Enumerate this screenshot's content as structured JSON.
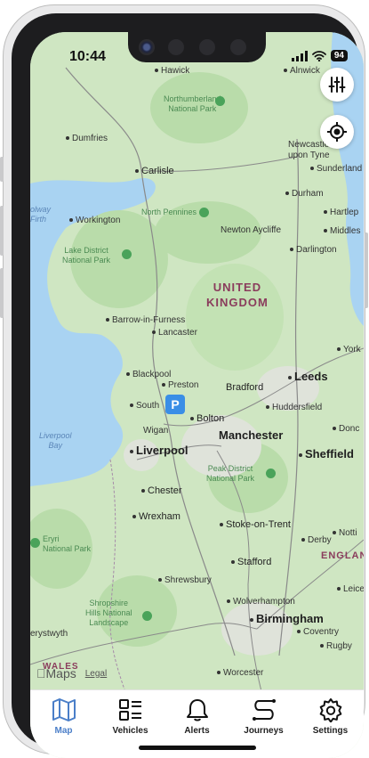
{
  "status": {
    "time": "10:44",
    "battery": "94"
  },
  "map": {
    "country": "UNITED\nKINGDOM",
    "region": "ENGLAND",
    "cities": [
      "Manchester",
      "Liverpool",
      "Leeds",
      "Sheffield",
      "Birmingham"
    ],
    "towns": {
      "hawick": "Hawick",
      "alnwick": "Alnwick",
      "dumfries": "Dumfries",
      "carlisle": "Carlisle",
      "newcastle": "Newcastle\nupon Tyne",
      "sunderland": "Sunderland",
      "durham": "Durham",
      "hartlepool": "Hartlep",
      "middlesbrough": "Middles",
      "workington": "Workington",
      "newton_aycliffe": "Newton Aycliffe",
      "darlington": "Darlington",
      "barrow": "Barrow-in-Furness",
      "lancaster": "Lancaster",
      "york": "York",
      "blackpool": "Blackpool",
      "preston": "Preston",
      "bradford": "Bradford",
      "huddersfield": "Huddersfield",
      "southport": "South",
      "bolton": "Bolton",
      "wigan": "Wigan",
      "doncaster": "Donc",
      "chester": "Chester",
      "wrexham": "Wrexham",
      "stoke": "Stoke-on-Trent",
      "derby": "Derby",
      "nottingham": "Notti",
      "stafford": "Stafford",
      "shrewsbury": "Shrewsbury",
      "leicester": "Leice",
      "wolverhampton": "Wolverhampton",
      "coventry": "Coventry",
      "rugby": "Rugby",
      "aberystwyth": "erystwyth",
      "worcester": "Worcester",
      "wales": "WALES"
    },
    "parks": {
      "northumberland": "Northumberland\nNational Park",
      "north_pennines": "North Pennines",
      "lake_district": "Lake District\nNational Park",
      "peak_district": "Peak District\nNational Park",
      "eryri": "Eryri\nNational Park",
      "shropshire": "Shropshire\nHills National\nLandscape"
    },
    "seas": {
      "solway": "olway\nFirth",
      "liverpool_bay": "Liverpool\nBay"
    },
    "parking_label": "P",
    "attribution": "Maps",
    "legal": "Legal"
  },
  "tabs": [
    {
      "label": "Map",
      "icon": "map-icon"
    },
    {
      "label": "Vehicles",
      "icon": "list-icon"
    },
    {
      "label": "Alerts",
      "icon": "bell-icon"
    },
    {
      "label": "Journeys",
      "icon": "route-icon"
    },
    {
      "label": "Settings",
      "icon": "gear-icon"
    }
  ],
  "colors": {
    "accent": "#4a7ec8",
    "water": "#a9d3f2",
    "land": "#cfe6c2",
    "park": "#b9dcaa"
  }
}
